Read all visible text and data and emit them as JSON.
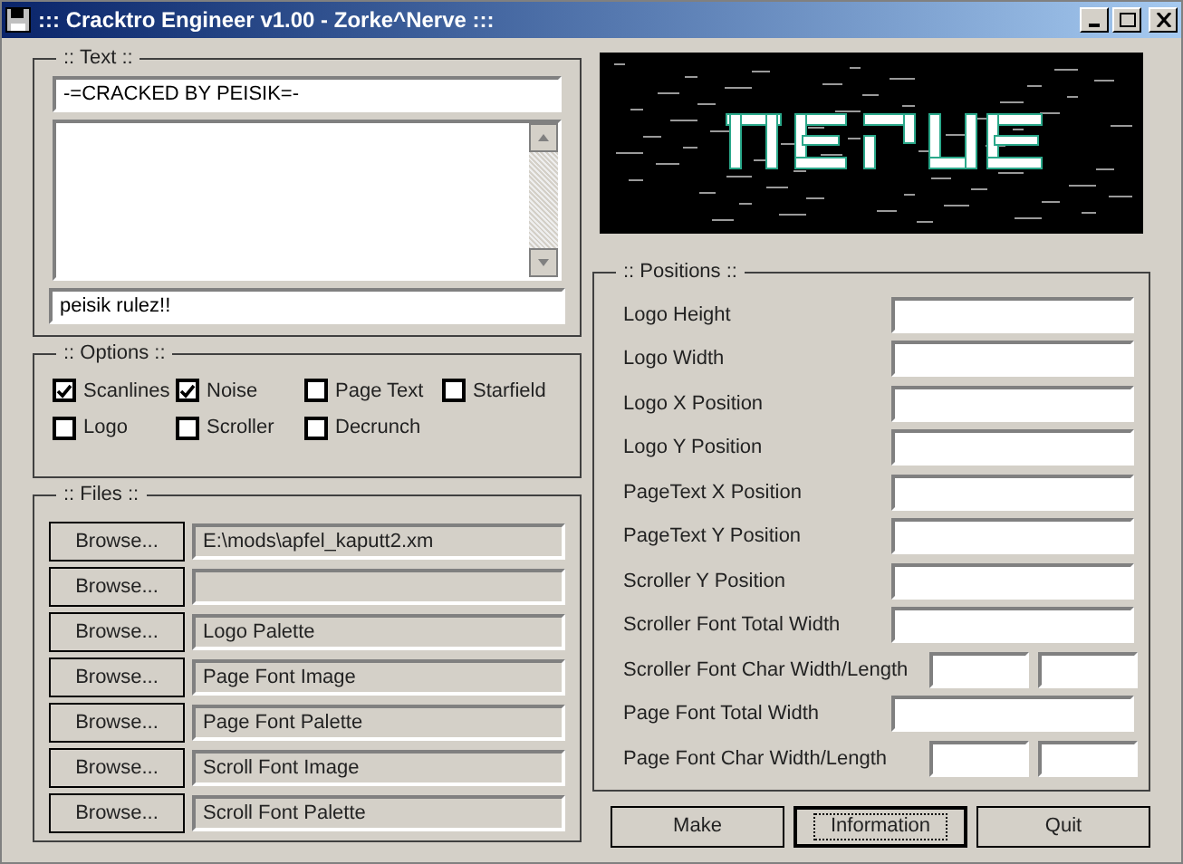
{
  "window": {
    "title": "::: Cracktro Engineer v1.00 - Zorke^Nerve :::"
  },
  "text_group": {
    "title": ":: Text ::",
    "header_field": {
      "value": "-=CRACKED BY PEISIK=-"
    },
    "footer_field": {
      "value": "peisik rulez!!"
    }
  },
  "options_group": {
    "title": ":: Options ::",
    "options": [
      {
        "label": "Scanlines",
        "checked": true
      },
      {
        "label": "Noise",
        "checked": true
      },
      {
        "label": "Page Text",
        "checked": false
      },
      {
        "label": "Starfield",
        "checked": false
      },
      {
        "label": "Logo",
        "checked": false
      },
      {
        "label": "Scroller",
        "checked": false
      },
      {
        "label": "Decrunch",
        "checked": false
      }
    ]
  },
  "files_group": {
    "title": ":: Files ::",
    "rows": [
      {
        "button": "Browse...",
        "value": "E:\\mods\\apfel_kaputt2.xm"
      },
      {
        "button": "Browse..."
      },
      {
        "button": "Browse...",
        "value": "Logo Palette"
      },
      {
        "button": "Browse...",
        "value": "Page Font Image"
      },
      {
        "button": "Browse...",
        "value": "Page Font Palette"
      },
      {
        "button": "Browse...",
        "value": "Scroll Font Image"
      },
      {
        "button": "Browse...",
        "value": "Scroll Font Palette"
      }
    ]
  },
  "positions_group": {
    "title": ":: Positions ::",
    "rows": [
      {
        "label": "Logo Height",
        "kind": "single"
      },
      {
        "label": "Logo Width",
        "kind": "single"
      },
      {
        "label": "Logo X Position",
        "kind": "single"
      },
      {
        "label": "Logo Y Position",
        "kind": "single"
      },
      {
        "label": "PageText X Position",
        "kind": "single"
      },
      {
        "label": "PageText Y Position",
        "kind": "single"
      },
      {
        "label": "Scroller Y Position",
        "kind": "single"
      },
      {
        "label": "Scroller Font Total Width",
        "kind": "single"
      },
      {
        "label": "Scroller Font Char Width/Length",
        "kind": "pair"
      },
      {
        "label": "Page Font Total Width",
        "kind": "single"
      },
      {
        "label": "Page Font Char Width/Length",
        "kind": "pair"
      }
    ]
  },
  "buttons": [
    {
      "label": "Make",
      "default": false
    },
    {
      "label": "Information",
      "default": true
    },
    {
      "label": "Quit",
      "default": false
    }
  ]
}
